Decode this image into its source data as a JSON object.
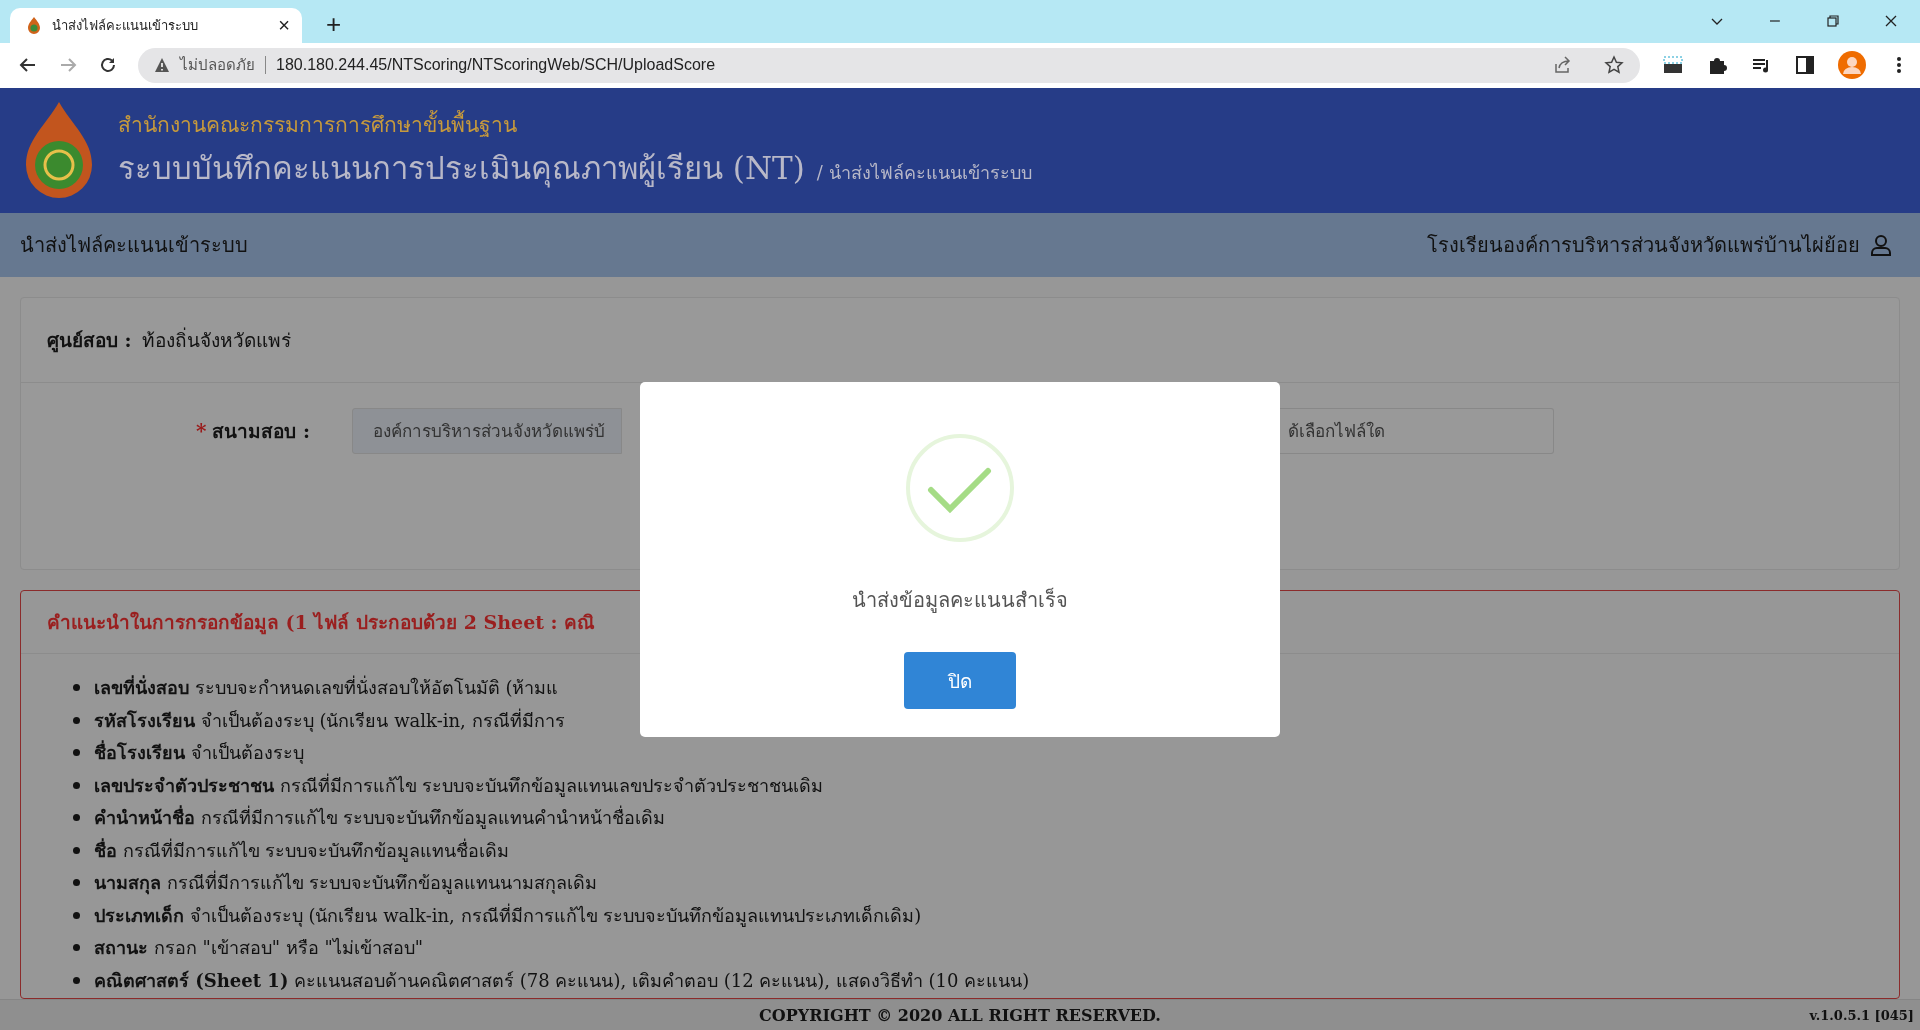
{
  "browser": {
    "tab": {
      "title": "นำส่งไฟล์คะแนนเข้าระบบ",
      "close": "×"
    },
    "new_tab": "+",
    "security": "ไม่ปลอดภัย",
    "url": "180.180.244.45/NTScoring/NTScoringWeb/SCH/UploadScore"
  },
  "header": {
    "org": "สำนักงานคณะกรรมการการศึกษาขั้นพื้นฐาน",
    "title": "ระบบบันทึกคะแนนการประเมินคุณภาพผู้เรียน (NT)",
    "breadcrumb": "/ นำส่งไฟล์คะแนนเข้าระบบ"
  },
  "navbar": {
    "page": "นำส่งไฟล์คะแนนเข้าระบบ",
    "school": "โรงเรียนองค์การบริหารส่วนจังหวัดแพร่บ้านไผ่ย้อย"
  },
  "center": {
    "label": "ศูนย์สอบ :",
    "value": "ท้องถิ่นจังหวัดแพร่"
  },
  "form": {
    "required_mark": "*",
    "label": "สนามสอบ :",
    "venue_value": "องค์การบริหารส่วนจังหวัดแพร่บ้",
    "file_placeholder": "ด้เลือกไฟล์ใด"
  },
  "instructions": {
    "title": "คำแนะนำในการกรอกข้อมูล (1 ไฟล์ ประกอบด้วย 2 Sheet : คณิ",
    "items": [
      "**เลขที่นั่งสอบ** ระบบจะกำหนดเลขที่นั่งสอบให้อัตโนมัติ (ห้ามแ",
      "**รหัสโรงเรียน** จำเป็นต้องระบุ (นักเรียน walk-in, กรณีที่มีการ",
      "**ชื่อโรงเรียน** จำเป็นต้องระบุ",
      "**เลขประจำตัวประชาชน** กรณีที่มีการแก้ไข ระบบจะบันทึกข้อมูลแทนเลขประจำตัวประชาชนเดิม",
      "**คำนำหน้าชื่อ** กรณีที่มีการแก้ไข ระบบจะบันทึกข้อมูลแทนคำนำหน้าชื่อเดิม",
      "**ชื่อ** กรณีที่มีการแก้ไข ระบบจะบันทึกข้อมูลแทนชื่อเดิม",
      "**นามสกุล** กรณีที่มีการแก้ไข ระบบจะบันทึกข้อมูลแทนนามสกุลเดิม",
      "**ประเภทเด็ก** จำเป็นต้องระบุ (นักเรียน walk-in, กรณีที่มีการแก้ไข ระบบจะบันทึกข้อมูลแทนประเภทเด็กเดิม)",
      "**สถานะ** กรอก \"เข้าสอบ\" หรือ \"ไม่เข้าสอบ\"",
      "**คณิตศาสตร์ (Sheet 1)** คะแนนสอบด้านคณิตศาสตร์ (78 คะแนน), เติมคำตอบ (12 คะแนน), แสดงวิธีทำ (10 คะแนน)"
    ]
  },
  "modal": {
    "message": "นำส่งข้อมูลคะแนนสำเร็จ",
    "button": "ปิด"
  },
  "footer": {
    "copyright": "COPYRIGHT © 2020 ALL RIGHT RESERVED.",
    "version": "v.1.0.5.1 [045]"
  }
}
